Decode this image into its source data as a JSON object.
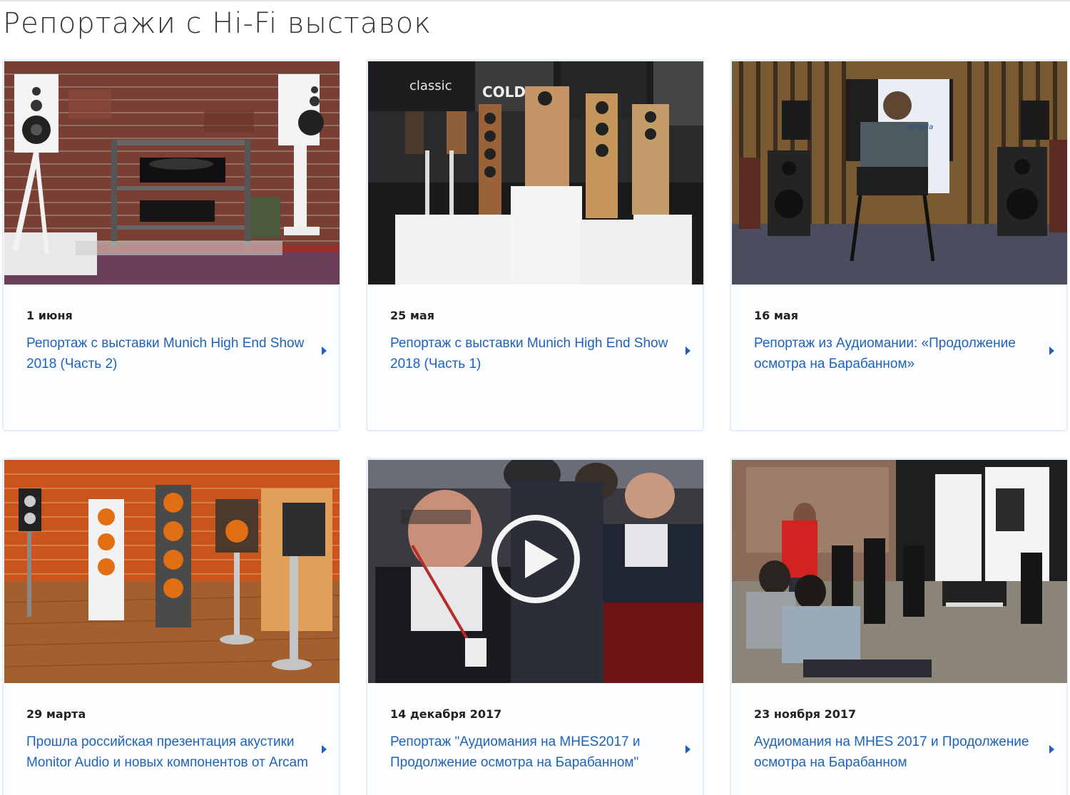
{
  "page": {
    "title": "Репортажи с Hi-Fi выставок"
  },
  "cards": [
    {
      "date": "1 июня",
      "title": "Репортаж с выставки Munich High End Show 2018 (Часть 2)",
      "image": "speakers-brick-wall-turntable"
    },
    {
      "date": "25 мая",
      "title": "Репортаж с выставки Munich High End Show 2018 (Часть 1)",
      "image": "speakers-exhibition-stand"
    },
    {
      "date": "16 мая",
      "title": "Репортаж из Аудиомании: «Продолжение осмотра на Барабанном»",
      "image": "listening-room-man-in-chair"
    },
    {
      "date": "29 марта",
      "title": "Прошла российская презентация акустики Monitor Audio и новых компонентов от Arcam",
      "image": "monitor-audio-speakers-brick-wall"
    },
    {
      "date": "14 декабря 2017",
      "title": "Репортаж \"Аудиомания на MHES2017 и Продолжение осмотра на Барабанном\"",
      "image": "video-crowd-at-show",
      "has_video": true
    },
    {
      "date": "23 ноября 2017",
      "title": "Аудиомания на MHES 2017 и Продолжение осмотра на Барабанном",
      "image": "listening-room-people-on-floor"
    }
  ],
  "colors": {
    "link": "#1f63b8",
    "card_bg": "#eef5fc",
    "card_border": "#e4eef8",
    "date": "#222222",
    "title": "#333333"
  },
  "icons": {
    "chevron": "chevron-right-icon",
    "play": "play-icon"
  }
}
